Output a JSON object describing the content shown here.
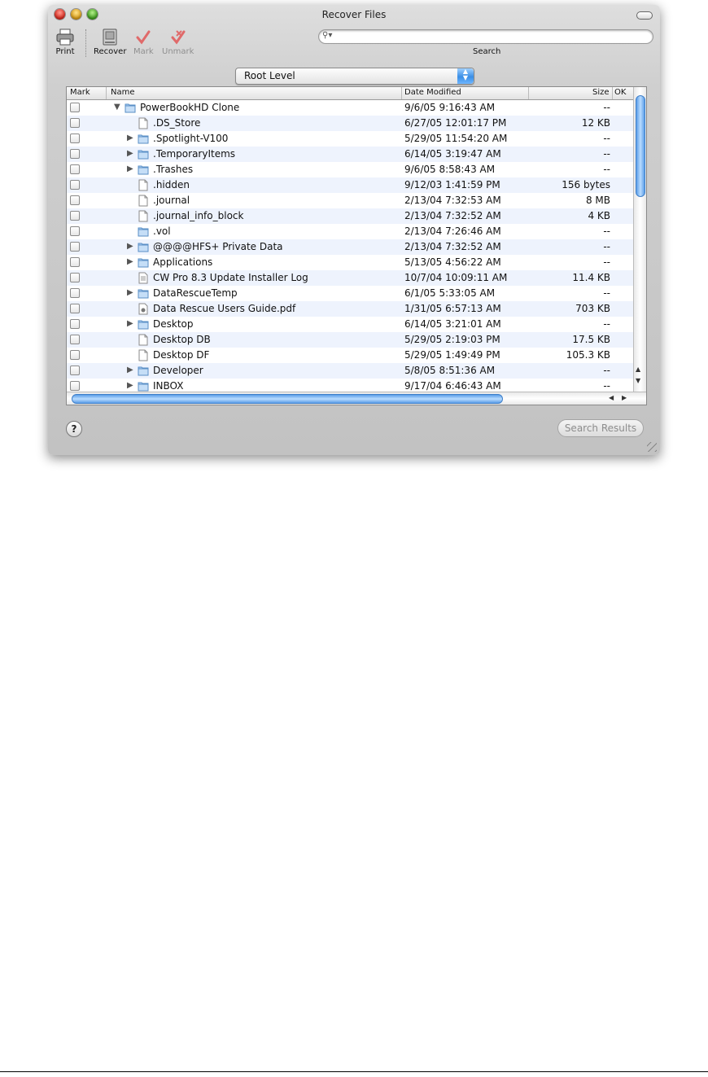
{
  "window": {
    "title": "Recover Files"
  },
  "toolbar": {
    "print_label": "Print",
    "recover_label": "Recover",
    "mark_label": "Mark",
    "unmark_label": "Unmark",
    "search_label": "Search",
    "search_value": ""
  },
  "popup": {
    "selected": "Root Level"
  },
  "columns": {
    "mark": "Mark",
    "name": "Name",
    "date": "Date Modified",
    "size": "Size",
    "ok": "OK"
  },
  "rows": [
    {
      "name": "PowerBookHD Clone",
      "date": "9/6/05 9:16:43 AM",
      "size": "--"
    },
    {
      "name": ".DS_Store",
      "date": "6/27/05 12:01:17 PM",
      "size": "12 KB"
    },
    {
      "name": ".Spotlight-V100",
      "date": "5/29/05 11:54:20 AM",
      "size": "--"
    },
    {
      "name": ".TemporaryItems",
      "date": "6/14/05 3:19:47 AM",
      "size": "--"
    },
    {
      "name": ".Trashes",
      "date": "9/6/05 8:58:43 AM",
      "size": "--"
    },
    {
      "name": ".hidden",
      "date": "9/12/03 1:41:59 PM",
      "size": "156 bytes"
    },
    {
      "name": ".journal",
      "date": "2/13/04 7:32:53 AM",
      "size": "8 MB"
    },
    {
      "name": ".journal_info_block",
      "date": "2/13/04 7:32:52 AM",
      "size": "4 KB"
    },
    {
      "name": ".vol",
      "date": "2/13/04 7:26:46 AM",
      "size": "--"
    },
    {
      "name": "@@@@HFS+ Private Data",
      "date": "2/13/04 7:32:52 AM",
      "size": "--"
    },
    {
      "name": "Applications",
      "date": "5/13/05 4:56:22 AM",
      "size": "--"
    },
    {
      "name": "CW Pro 8.3 Update Installer Log",
      "date": "10/7/04 10:09:11 AM",
      "size": "11.4 KB"
    },
    {
      "name": "DataRescueTemp",
      "date": "6/1/05 5:33:05 AM",
      "size": "--"
    },
    {
      "name": "Data Rescue Users Guide.pdf",
      "date": "1/31/05 6:57:13 AM",
      "size": "703 KB"
    },
    {
      "name": "Desktop",
      "date": "6/14/05 3:21:01 AM",
      "size": "--"
    },
    {
      "name": "Desktop DB",
      "date": "5/29/05 2:19:03 PM",
      "size": "17.5 KB"
    },
    {
      "name": "Desktop DF",
      "date": "5/29/05 1:49:49 PM",
      "size": "105.3 KB"
    },
    {
      "name": "Developer",
      "date": "5/8/05 8:51:36 AM",
      "size": "--"
    },
    {
      "name": "INBOX",
      "date": "9/17/04 6:46:43 AM",
      "size": "--"
    }
  ],
  "footer": {
    "help_label": "?",
    "search_results_label": "Search Results"
  }
}
